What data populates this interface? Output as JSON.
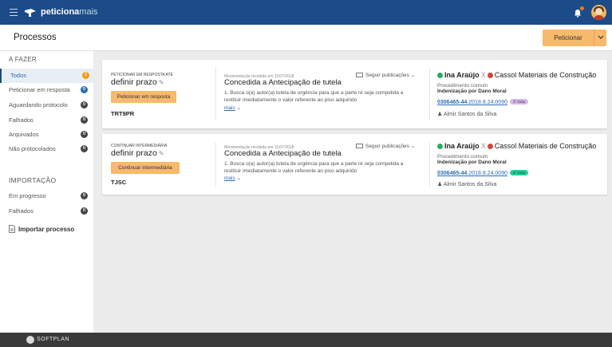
{
  "topbar": {
    "brand_bold": "peticiona",
    "brand_light": "mais"
  },
  "header": {
    "title": "Processos",
    "primary_button": "Peticionar"
  },
  "sidebar": {
    "section1_title": "A FAZER",
    "items": [
      {
        "label": "Todos",
        "count": "2",
        "active": true
      },
      {
        "label": "Peticionar em resposta",
        "count": "0"
      },
      {
        "label": "Aguardando protocolo",
        "count": "0"
      },
      {
        "label": "Falhados",
        "count": "0"
      },
      {
        "label": "Arquivados",
        "count": "0"
      },
      {
        "label": "Não protocolados",
        "count": "0"
      }
    ],
    "section2_title": "IMPORTAÇÃO",
    "import_items": [
      {
        "label": "Em progresso",
        "count": "0"
      },
      {
        "label": "Falhados",
        "count": "0"
      }
    ],
    "import_link": "Importar processo"
  },
  "cards": [
    {
      "task_label": "PETICIONAR EM RESPOSTA ATÉ",
      "deadline_title": "definir prazo",
      "action_button": "Peticionar em resposta",
      "court": "TRT9PR",
      "movement_date": "Movimentação recebida em 11/07/2018",
      "movement_title": "Concedida a Antecipação de tutela",
      "movement_text": "1. Busca o(a) autor(a) tutela de urgência para que a parte ré seja compelida a restituir imediatamente o valor referente ao piso adquirido",
      "more_link": "mais",
      "follow_label": "Seguir publicações",
      "party_active": "Ina Araújo",
      "separator": "X",
      "party_passive": "Cassol Materiais de Construção",
      "procedure_type": "Procedimento comum",
      "procedure_name": "Indenização por Dano Moral",
      "process_number_bold": "0306465-44",
      "process_number_rest": ".2018.8.24.0090",
      "grau": "1º Grau",
      "lawyer": "Almir Santos da Silva"
    },
    {
      "task_label": "CONTINUAR INTERMEDIÁRIA",
      "deadline_title": "definir prazo",
      "action_button": "Continuar intermediária",
      "court": "TJSC",
      "movement_date": "Movimentação recebida em 11/07/2018",
      "movement_title": "Concedida a Antecipação de tutela",
      "movement_text": "1. Busca o(a) autor(a) tutela de urgência para que a parte ré seja compelida a restituir imediatamente o valor referente ao piso adquirido",
      "more_link": "mais",
      "follow_label": "Seguir publicações",
      "party_active": "Ina Araújo",
      "separator": "X",
      "party_passive": "Cassol Materiais de Construção",
      "procedure_type": "Procedimento comum",
      "procedure_name": "Indenização por Dano Moral",
      "process_number_bold": "0306465-44",
      "process_number_rest": ".2018.8.24.0090",
      "grau": "2º Grau",
      "lawyer": "Almir Santos da Silva"
    }
  ],
  "footer": {
    "brand": "SOFTPLAN"
  },
  "colors": {
    "topbar": "#1b4b88",
    "accent_button": "#f7b96c",
    "link": "#2a6cb5",
    "party_active": "#27ae60",
    "party_passive": "#d9423a",
    "footer": "#3a3a3a"
  }
}
